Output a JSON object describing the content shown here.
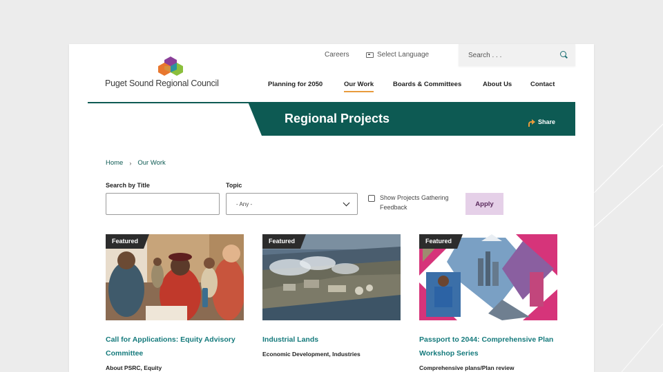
{
  "utility": {
    "careers": "Careers",
    "language": "Select Language",
    "search_placeholder": "Search . . ."
  },
  "logo": {
    "text": "Puget Sound Regional Council",
    "colors": [
      "#8a3f99",
      "#e8772e",
      "#1b8ab0",
      "#8bbf3c"
    ]
  },
  "nav": {
    "items": [
      "Planning for 2050",
      "Our Work",
      "Boards & Committees",
      "About Us",
      "Contact"
    ],
    "active": "Our Work"
  },
  "hero": {
    "title": "Regional Projects",
    "share": "Share"
  },
  "breadcrumb": [
    "Home",
    "Our Work"
  ],
  "filters": {
    "title_label": "Search by Title",
    "title_value": "",
    "topic_label": "Topic",
    "topic_selected": "- Any -",
    "checkbox_label": "Show Projects Gathering Feedback",
    "checkbox_checked": false,
    "apply": "Apply"
  },
  "cards": [
    {
      "badge": "Featured",
      "title": "Call for Applications: Equity Advisory Committee",
      "tags": "About PSRC, Equity"
    },
    {
      "badge": "Featured",
      "title": "Industrial Lands",
      "tags": "Economic Development, Industries"
    },
    {
      "badge": "Featured",
      "title": "Passport to 2044: Comprehensive Plan Workshop Series",
      "tags": "Comprehensive plans/Plan review"
    }
  ],
  "colors": {
    "brand_green": "#0d5a53",
    "link_teal": "#157a7c",
    "accent_orange": "#e89b3c",
    "apply_bg": "#e5d0e8"
  }
}
